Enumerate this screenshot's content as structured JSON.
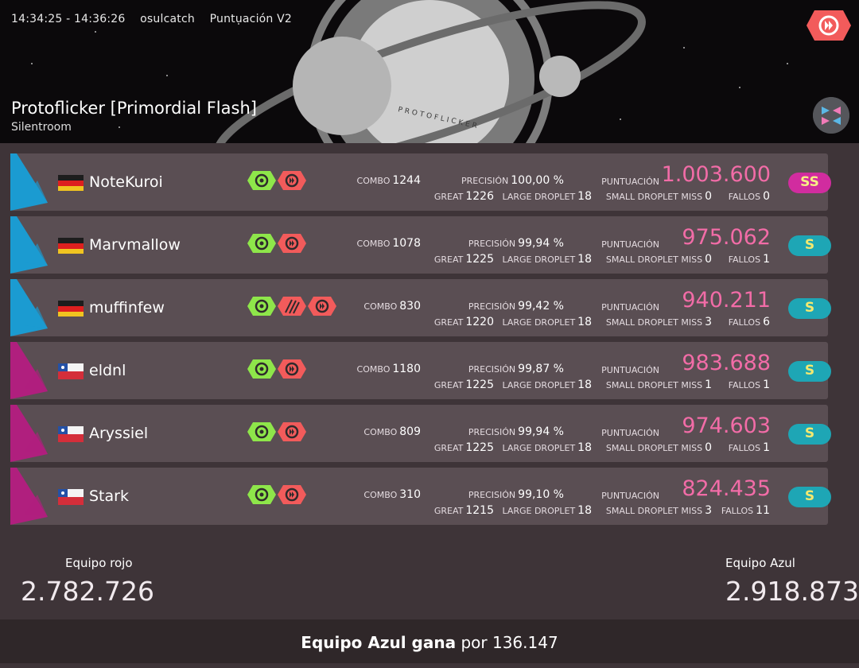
{
  "header": {
    "time_range": "14:34:25 - 14:36:26",
    "mapper": "osulcatch",
    "scoring": "Puntuación V2",
    "map_title": "Protoflicker [Primordial Flash]",
    "artist": "Silentroom",
    "background_text": "PROTOFLICKER",
    "mod_icon": "double-time-mod-icon",
    "ruleset_icon": "catch-ruleset-icon"
  },
  "labels": {
    "combo": "COMBO",
    "accuracy": "PRECISIÓN",
    "score": "PUNTUACIÓN",
    "great": "GREAT",
    "large_droplet": "LARGE DROPLET",
    "small_droplet_miss": "SMALL DROPLET MISS",
    "misses": "FALLOS"
  },
  "colors": {
    "red_team": "#1b9bd1",
    "blue_team": "#b01f7e",
    "score_pink": "#f26ca7",
    "mod_green": "#8ee64a",
    "mod_red": "#f25b5b",
    "grade_ss": "#d12c9f",
    "grade_s": "#1ea6b5"
  },
  "players": [
    {
      "name": "NoteKuroi",
      "flag": "germany",
      "team": "red",
      "combo": "1244",
      "accuracy": "100,00 %",
      "score": "1.003.600",
      "great": "1226",
      "large_droplet": "18",
      "small_droplet_miss": "0",
      "misses": "0",
      "grade": "SS",
      "mods": [
        "no-fail-mod-icon",
        "double-time-mod-icon"
      ]
    },
    {
      "name": "Marvmallow",
      "flag": "germany",
      "team": "red",
      "combo": "1078",
      "accuracy": "99,94 %",
      "score": "975.062",
      "great": "1225",
      "large_droplet": "18",
      "small_droplet_miss": "0",
      "misses": "1",
      "grade": "S",
      "mods": [
        "no-fail-mod-icon",
        "double-time-mod-icon"
      ]
    },
    {
      "name": "muffinfew",
      "flag": "germany",
      "team": "red",
      "combo": "830",
      "accuracy": "99,42 %",
      "score": "940.211",
      "great": "1220",
      "large_droplet": "18",
      "small_droplet_miss": "3",
      "misses": "6",
      "grade": "S",
      "mods": [
        "no-fail-mod-icon",
        "hard-rock-mod-icon",
        "double-time-mod-icon"
      ]
    },
    {
      "name": "eldnl",
      "flag": "chile",
      "team": "blue",
      "combo": "1180",
      "accuracy": "99,87 %",
      "score": "983.688",
      "great": "1225",
      "large_droplet": "18",
      "small_droplet_miss": "1",
      "misses": "1",
      "grade": "S",
      "mods": [
        "no-fail-mod-icon",
        "double-time-mod-icon"
      ]
    },
    {
      "name": "Aryssiel",
      "flag": "chile",
      "team": "blue",
      "combo": "809",
      "accuracy": "99,94 %",
      "score": "974.603",
      "great": "1225",
      "large_droplet": "18",
      "small_droplet_miss": "0",
      "misses": "1",
      "grade": "S",
      "mods": [
        "no-fail-mod-icon",
        "double-time-mod-icon"
      ]
    },
    {
      "name": "Stark",
      "flag": "chile",
      "team": "blue",
      "combo": "310",
      "accuracy": "99,10 %",
      "score": "824.435",
      "great": "1215",
      "large_droplet": "18",
      "small_droplet_miss": "3",
      "misses": "11",
      "grade": "S",
      "mods": [
        "no-fail-mod-icon",
        "double-time-mod-icon"
      ]
    }
  ],
  "teams": {
    "red": {
      "label": "Equipo rojo",
      "score": "2.782.726"
    },
    "blue": {
      "label": "Equipo Azul",
      "score": "2.918.873"
    }
  },
  "result": {
    "winner": "Equipo Azul gana",
    "by": "por",
    "margin": "136.147"
  }
}
